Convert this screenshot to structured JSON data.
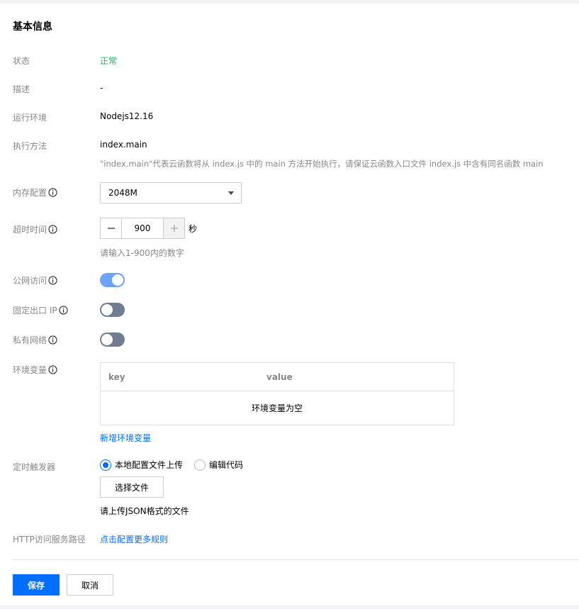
{
  "section": {
    "title": "基本信息"
  },
  "status": {
    "label": "状态",
    "value": "正常"
  },
  "description": {
    "label": "描述",
    "value": "-"
  },
  "runtime": {
    "label": "运行环境",
    "value": "Nodejs12.16"
  },
  "handler": {
    "label": "执行方法",
    "value": "index.main",
    "hint": "\"index.main\"代表云函数将从 index.js 中的 main 方法开始执行，请保证云函数入口文件 index.js 中含有同名函数 main"
  },
  "memory": {
    "label": "内存配置",
    "selected": "2048M"
  },
  "timeout": {
    "label": "超时时间",
    "value": "900",
    "unit": "秒",
    "hint": "请输入1-900内的数字"
  },
  "public_access": {
    "label": "公网访问",
    "enabled": true
  },
  "fixed_ip": {
    "label": "固定出口 IP",
    "enabled": false
  },
  "private_network": {
    "label": "私有网络",
    "enabled": false
  },
  "env_vars": {
    "label": "环境变量",
    "col_key": "key",
    "col_value": "value",
    "empty_text": "环境变量为空",
    "add_link": "新增环境变量"
  },
  "timer_trigger": {
    "label": "定时触发器",
    "options": [
      "本地配置文件上传",
      "编辑代码"
    ],
    "selected_index": 0,
    "file_button": "选择文件",
    "hint": "请上传JSON格式的文件"
  },
  "http_path": {
    "label": "HTTP访问服务路径",
    "link": "点击配置更多规则"
  },
  "footer": {
    "save": "保存",
    "cancel": "取消"
  },
  "colors": {
    "accent": "#006eff",
    "success": "#0abf5b",
    "toggle_on": "#6aa4ff",
    "toggle_off": "#6f7d92"
  }
}
